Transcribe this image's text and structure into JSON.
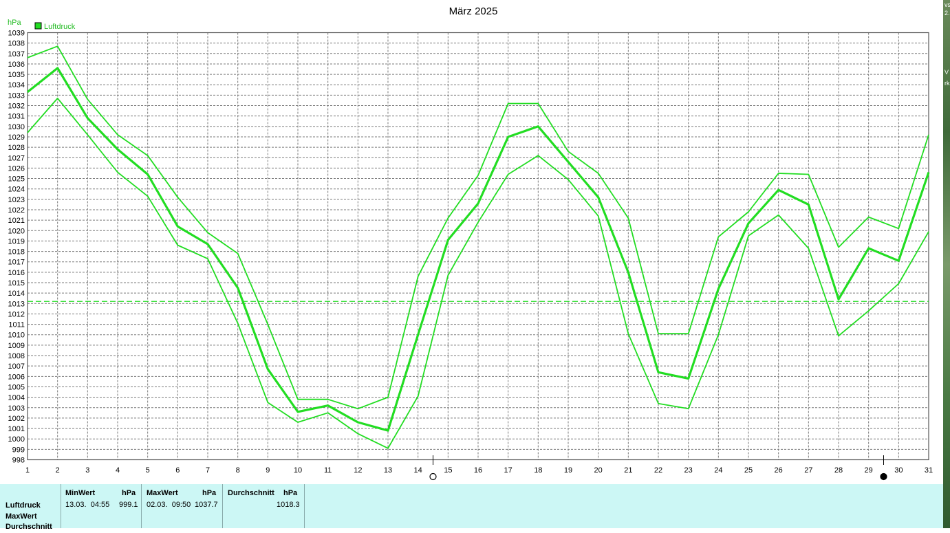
{
  "chart_data": {
    "type": "line",
    "title": "März 2025",
    "ylabel": "hPa",
    "ylim": [
      998,
      1039
    ],
    "y_ticks": [
      998,
      999,
      1000,
      1001,
      1002,
      1003,
      1004,
      1005,
      1006,
      1007,
      1008,
      1009,
      1010,
      1011,
      1012,
      1013,
      1014,
      1015,
      1016,
      1017,
      1018,
      1019,
      1020,
      1021,
      1022,
      1023,
      1024,
      1025,
      1026,
      1027,
      1028,
      1029,
      1030,
      1031,
      1032,
      1033,
      1034,
      1035,
      1036,
      1037,
      1038,
      1039
    ],
    "x": [
      1,
      2,
      3,
      4,
      5,
      6,
      7,
      8,
      9,
      10,
      11,
      12,
      13,
      14,
      15,
      16,
      17,
      18,
      19,
      20,
      21,
      22,
      23,
      24,
      25,
      26,
      27,
      28,
      29,
      30,
      31
    ],
    "legend": [
      "Luftdruck"
    ],
    "legend_position": "top-left",
    "grid": true,
    "reference_line": 1013.2,
    "color": "#22dd22",
    "series": [
      {
        "name": "Luftdruck",
        "role": "max",
        "values": [
          1036.6,
          1037.7,
          1032.6,
          1029.2,
          1027.2,
          1023.2,
          1019.8,
          1017.8,
          1011.0,
          1003.8,
          1003.8,
          1002.9,
          1004.0,
          1015.6,
          1021.2,
          1025.3,
          1032.2,
          1032.2,
          1027.6,
          1025.5,
          1021.2,
          1010.1,
          1010.1,
          1019.4,
          1021.8,
          1025.5,
          1025.4,
          1018.4,
          1021.3,
          1020.2,
          1029.2
        ]
      },
      {
        "name": "Luftdruck",
        "role": "avg",
        "values": [
          1033.3,
          1035.6,
          1030.8,
          1027.8,
          1025.4,
          1020.4,
          1018.7,
          1014.5,
          1006.7,
          1002.6,
          1003.2,
          1001.6,
          1000.8,
          1010.0,
          1019.1,
          1022.6,
          1029.0,
          1030.0,
          1026.6,
          1023.2,
          1016.0,
          1006.4,
          1005.8,
          1014.4,
          1020.7,
          1023.9,
          1022.5,
          1013.4,
          1018.3,
          1017.1,
          1025.6
        ]
      },
      {
        "name": "Luftdruck",
        "role": "min",
        "values": [
          1029.4,
          1032.7,
          1029.2,
          1025.6,
          1023.3,
          1018.6,
          1017.3,
          1011.1,
          1003.5,
          1001.6,
          1002.5,
          1000.5,
          999.1,
          1004.1,
          1015.7,
          1020.8,
          1025.4,
          1027.2,
          1024.9,
          1021.4,
          1010.1,
          1003.4,
          1002.9,
          1010.0,
          1019.5,
          1021.5,
          1018.3,
          1009.9,
          1012.3,
          1014.9,
          1019.9
        ]
      }
    ],
    "moon_phases": [
      {
        "day": 14,
        "phase": "full-moon"
      },
      {
        "day": 29,
        "phase": "new-moon"
      }
    ]
  },
  "stats_table": {
    "row_labels": [
      "Luftdruck",
      "MaxWert",
      "Durchschnitt"
    ],
    "min": {
      "title": "MinWert",
      "unit": "hPa",
      "date": "13.03.  04:55",
      "value": "999.1"
    },
    "max": {
      "title": "MaxWert",
      "unit": "hPa",
      "date": "02.03.  09:50",
      "value": "1037.7"
    },
    "avg": {
      "title": "Durchschnitt",
      "unit": "hPa",
      "value": "1018.3"
    }
  },
  "right_strip": {
    "texts": [
      "vs",
      "2.",
      "V",
      "rk"
    ]
  }
}
